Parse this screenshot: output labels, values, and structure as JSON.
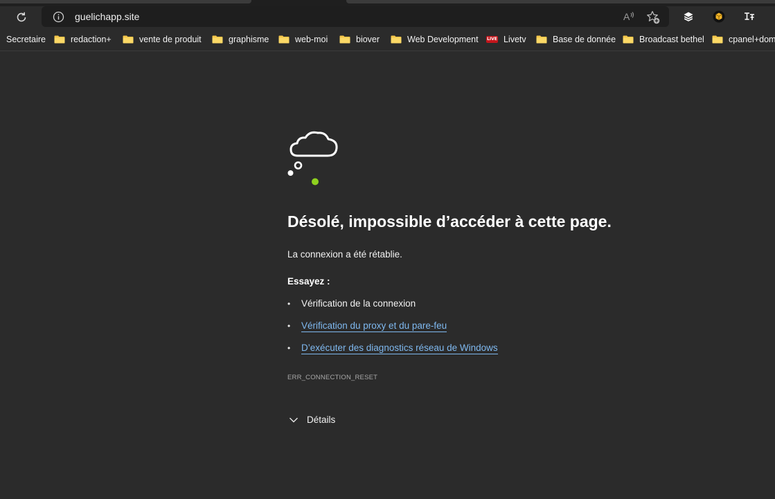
{
  "browser": {
    "address_bar": {
      "url": "guelichapp.site",
      "info_icon": "info-circle-icon",
      "read_aloud_label": "A",
      "add_favorite_icon": "star-plus-icon"
    },
    "toolbar_icons": [
      "reload-icon",
      "layers-icon",
      "cube-extension-icon",
      "translate-extension-icon"
    ]
  },
  "bookmarks": [
    {
      "label": "Secretaire",
      "type": "folder"
    },
    {
      "label": "redaction+",
      "type": "folder"
    },
    {
      "label": "vente de produit",
      "type": "folder"
    },
    {
      "label": "graphisme",
      "type": "folder"
    },
    {
      "label": "web-moi",
      "type": "folder"
    },
    {
      "label": "biover",
      "type": "folder"
    },
    {
      "label": "Web Development",
      "type": "folder"
    },
    {
      "label": "Livetv",
      "type": "live",
      "badge": "LIVE"
    },
    {
      "label": "Base de donnée",
      "type": "folder"
    },
    {
      "label": "Broadcast bethel",
      "type": "folder"
    },
    {
      "label": "cpanel+dom",
      "type": "folder"
    }
  ],
  "error_page": {
    "title": "Désolé, impossible d’accéder à cette page.",
    "message": "La connexion a été rétablie.",
    "try_label": "Essayez :",
    "suggestions": [
      {
        "text": "Vérification de la connexion",
        "link": false
      },
      {
        "text": "Vérification du proxy et du pare-feu",
        "link": true
      },
      {
        "text": "D’exécuter des diagnostics réseau de Windows",
        "link": true
      }
    ],
    "error_code": "ERR_CONNECTION_RESET",
    "details_label": "Détails"
  },
  "colors": {
    "page_bg": "#2b2b2b",
    "link": "#7fb9f0",
    "accent_dot": "#8fd11f",
    "folder": "#f4c64a"
  }
}
